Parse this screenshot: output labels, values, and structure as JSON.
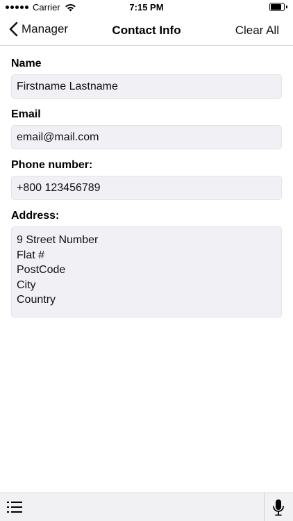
{
  "status_bar": {
    "carrier": "Carrier",
    "time": "7:15 PM",
    "wifi_icon": "wifi-icon",
    "battery_icon": "battery-icon"
  },
  "nav": {
    "back_label": "Manager",
    "back_icon": "chevron-left-icon",
    "title": "Contact Info",
    "clear_label": "Clear All"
  },
  "form": {
    "name_label": "Name",
    "name_value": "Firstname Lastname",
    "email_label": "Email",
    "email_value": "email@mail.com",
    "phone_label": "Phone number:",
    "phone_value": "+800 123456789",
    "address_label": "Address:",
    "address_lines": [
      "9 Street Number",
      "Flat #",
      "PostCode",
      "City",
      "Country"
    ]
  },
  "toolbar": {
    "list_icon": "list-icon",
    "mic_icon": "microphone-icon"
  },
  "colors": {
    "field_background": "#f0f0f5",
    "toolbar_background": "#f1f1f3",
    "text": "#000000"
  }
}
